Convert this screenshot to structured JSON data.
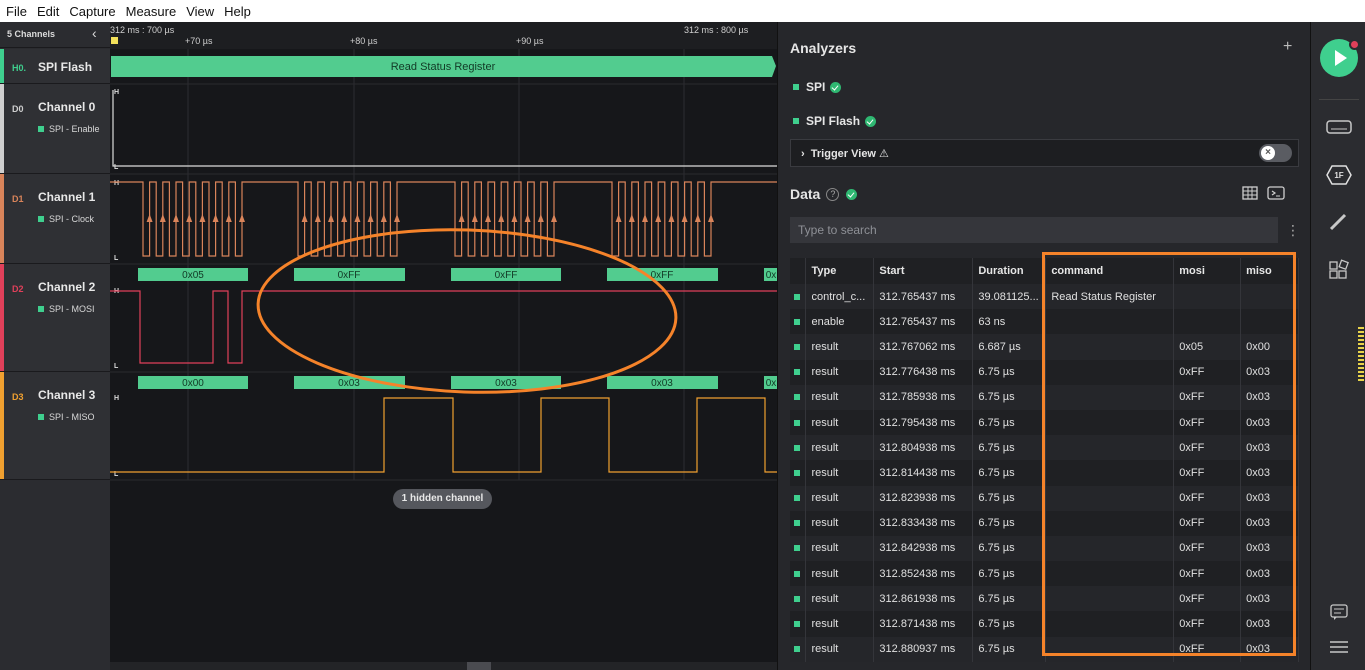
{
  "menu": [
    "File",
    "Edit",
    "Capture",
    "Measure",
    "View",
    "Help"
  ],
  "channels_header": "5 Channels",
  "channels": [
    {
      "code": "H0.",
      "name": "SPI Flash",
      "sub": "",
      "color": "#3fcf8e"
    },
    {
      "code": "D0",
      "name": "Channel 0",
      "sub": "SPI - Enable",
      "color": "#cfcfcf"
    },
    {
      "code": "D1",
      "name": "Channel 1",
      "sub": "SPI - Clock",
      "color": "#d9845a"
    },
    {
      "code": "D2",
      "name": "Channel 2",
      "sub": "SPI - MOSI",
      "color": "#e0405a"
    },
    {
      "code": "D3",
      "name": "Channel 3",
      "sub": "SPI - MISO",
      "color": "#f0a030"
    }
  ],
  "timeline": {
    "left_time": "312 ms : 700 µs",
    "right_time": "312 ms : 800 µs",
    "ticks": [
      "+70 µs",
      "+80 µs",
      "+90 µs"
    ]
  },
  "waveform": {
    "flash_frame": "Read Status Register",
    "mosi_frames": [
      "0x05",
      "0xFF",
      "0xFF",
      "0xFF",
      "0x"
    ],
    "miso_frames": [
      "0x00",
      "0x03",
      "0x03",
      "0x03",
      "0x"
    ],
    "level_high": "H",
    "level_low": "L",
    "hidden_channels": "1 hidden channel"
  },
  "analyzers": {
    "title": "Analyzers",
    "add": "+",
    "items": [
      "SPI",
      "SPI Flash"
    ],
    "trigger_view": "Trigger View ⚠"
  },
  "data_panel": {
    "title": "Data",
    "help": "?",
    "search_placeholder": "Type to search",
    "columns": [
      "Type",
      "Start",
      "Duration",
      "command",
      "mosi",
      "miso"
    ],
    "rows": [
      [
        "control_c...",
        "312.765437 ms",
        "39.081125...",
        "Read Status Register",
        "",
        ""
      ],
      [
        "enable",
        "312.765437 ms",
        "63 ns",
        "",
        "",
        ""
      ],
      [
        "result",
        "312.767062 ms",
        "6.687 µs",
        "",
        "0x05",
        "0x00"
      ],
      [
        "result",
        "312.776438 ms",
        "6.75 µs",
        "",
        "0xFF",
        "0x03"
      ],
      [
        "result",
        "312.785938 ms",
        "6.75 µs",
        "",
        "0xFF",
        "0x03"
      ],
      [
        "result",
        "312.795438 ms",
        "6.75 µs",
        "",
        "0xFF",
        "0x03"
      ],
      [
        "result",
        "312.804938 ms",
        "6.75 µs",
        "",
        "0xFF",
        "0x03"
      ],
      [
        "result",
        "312.814438 ms",
        "6.75 µs",
        "",
        "0xFF",
        "0x03"
      ],
      [
        "result",
        "312.823938 ms",
        "6.75 µs",
        "",
        "0xFF",
        "0x03"
      ],
      [
        "result",
        "312.833438 ms",
        "6.75 µs",
        "",
        "0xFF",
        "0x03"
      ],
      [
        "result",
        "312.842938 ms",
        "6.75 µs",
        "",
        "0xFF",
        "0x03"
      ],
      [
        "result",
        "312.852438 ms",
        "6.75 µs",
        "",
        "0xFF",
        "0x03"
      ],
      [
        "result",
        "312.861938 ms",
        "6.75 µs",
        "",
        "0xFF",
        "0x03"
      ],
      [
        "result",
        "312.871438 ms",
        "6.75 µs",
        "",
        "0xFF",
        "0x03"
      ],
      [
        "result",
        "312.880937 ms",
        "6.75 µs",
        "",
        "0xFF",
        "0x03"
      ]
    ]
  },
  "colors": {
    "accent_green": "#3fcf8e",
    "annotation_orange": "#f5832a",
    "clock_orange": "#d9845a",
    "mosi_red": "#e0405a",
    "miso_amber": "#f0a030"
  },
  "rail_icons": [
    "play-icon",
    "device-icon",
    "analyzer-icon",
    "measure-icon",
    "extensions-icon",
    "notes-icon",
    "menu-icon"
  ]
}
